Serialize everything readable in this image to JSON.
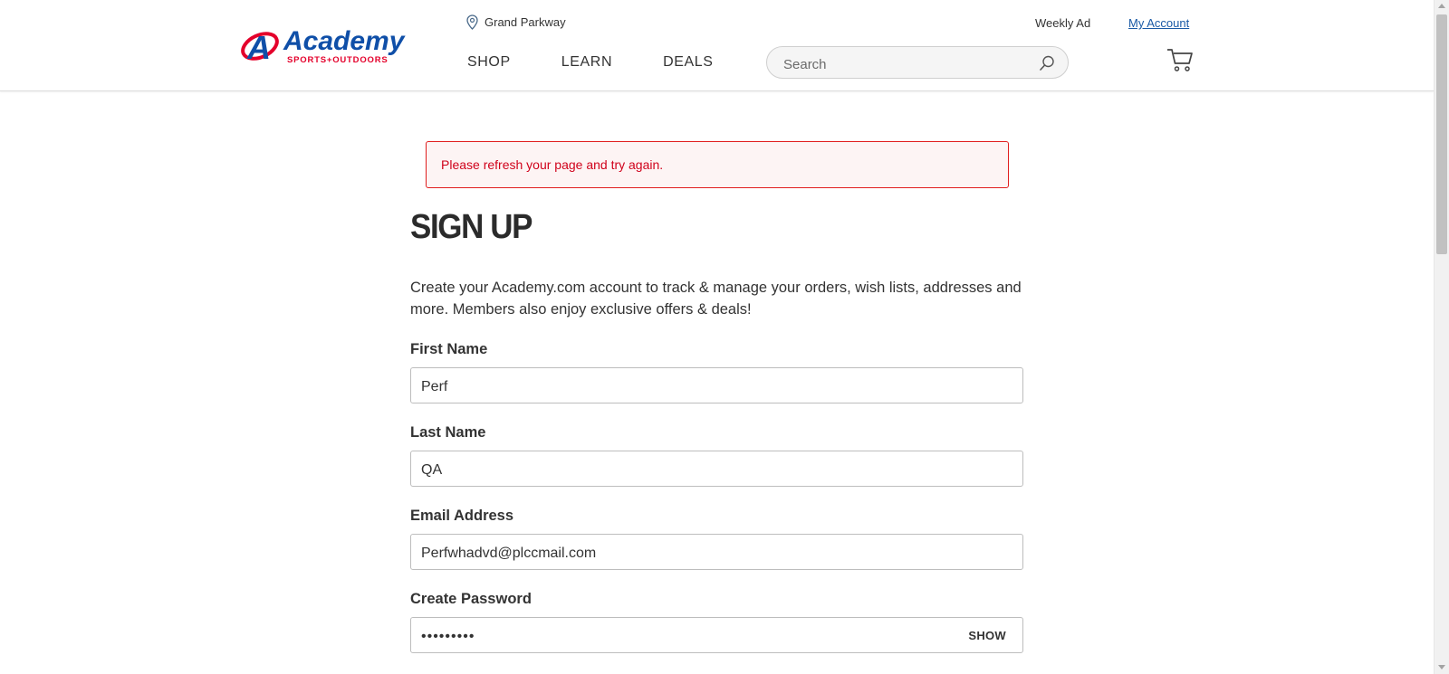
{
  "header": {
    "logo": {
      "brand": "Academy",
      "tagline": "SPORTS+OUTDOORS",
      "icon": "academy-a-logo"
    },
    "store": {
      "icon": "location-pin-icon",
      "name": "Grand Parkway"
    },
    "weekly_ad": "Weekly Ad",
    "my_account": "My Account",
    "nav": [
      "SHOP",
      "LEARN",
      "DEALS"
    ],
    "search": {
      "placeholder": "Search",
      "icon": "search-icon"
    },
    "cart_icon": "cart-icon"
  },
  "alert": {
    "message": "Please refresh your page and try again."
  },
  "page_title": "SIGN UP",
  "intro": "Create your Academy.com account to track & manage your orders, wish lists, addresses and more. Members also enjoy exclusive offers & deals!",
  "form": {
    "first_name": {
      "label": "First Name",
      "value": "Perf"
    },
    "last_name": {
      "label": "Last Name",
      "value": "QA"
    },
    "email": {
      "label": "Email Address",
      "value": "Perfwhadvd@plccmail.com"
    },
    "password": {
      "label": "Create Password",
      "value": "•••••••••",
      "toggle": "SHOW"
    }
  },
  "colors": {
    "brand_blue": "#0f4fa8",
    "brand_red": "#e4002b",
    "error_red": "#d0021b",
    "link_blue": "#1a5aa6"
  }
}
